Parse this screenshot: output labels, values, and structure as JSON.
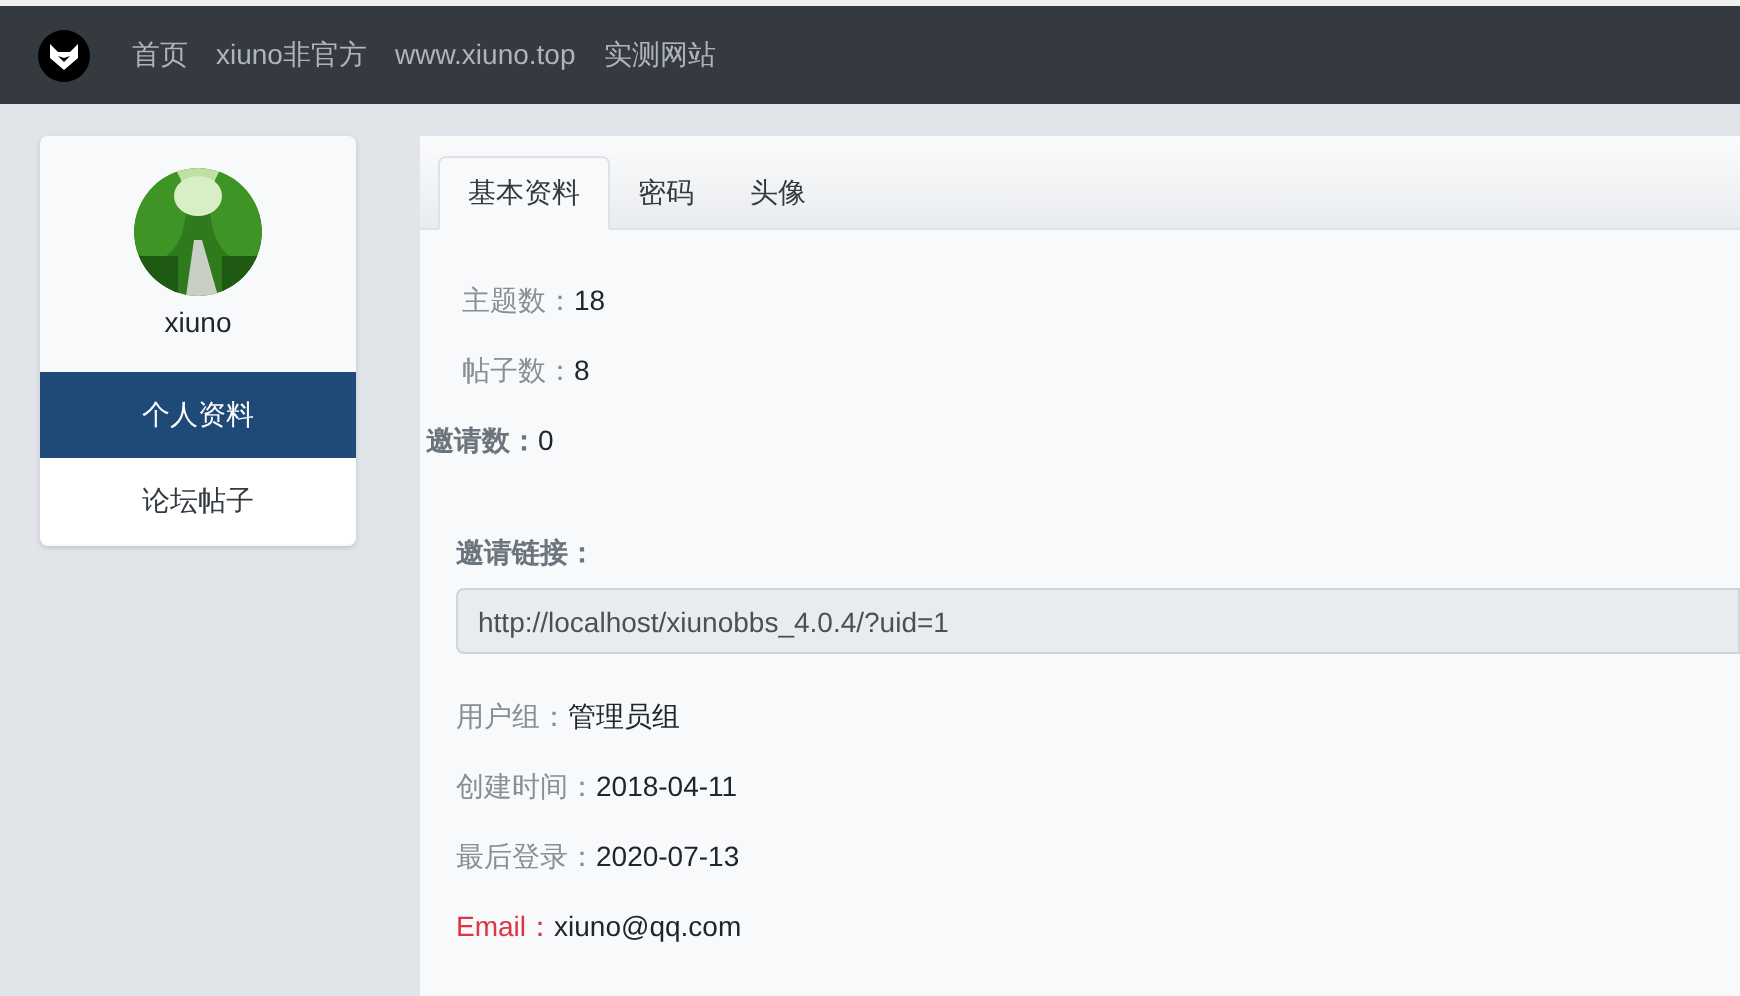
{
  "navbar": {
    "links": [
      "首页",
      "xiuno非官方",
      "www.xiuno.top",
      "实测网站"
    ]
  },
  "profile": {
    "username": "xiuno",
    "menu": [
      {
        "label": "个人资料",
        "selected": true
      },
      {
        "label": "论坛帖子",
        "selected": false
      }
    ]
  },
  "tabs": [
    {
      "label": "基本资料",
      "selected": true
    },
    {
      "label": "密码",
      "selected": false
    },
    {
      "label": "头像",
      "selected": false
    }
  ],
  "stats": [
    {
      "label": "主题数：",
      "value": "18",
      "kind": "plain"
    },
    {
      "label": "帖子数：",
      "value": "8",
      "kind": "plain"
    },
    {
      "label": "邀请数：",
      "value": "0",
      "kind": "strong"
    }
  ],
  "invite": {
    "label": "邀请链接：",
    "value": "http://localhost/xiunobbs_4.0.4/?uid=1"
  },
  "details": [
    {
      "label": "用户组：",
      "value": "管理员组",
      "kind": "plain"
    },
    {
      "label": "创建时间：",
      "value": "2018-04-11",
      "kind": "plain"
    },
    {
      "label": "最后登录：",
      "value": "2020-07-13",
      "kind": "plain"
    },
    {
      "label": "Email：",
      "value": "xiuno@qq.com",
      "kind": "alert"
    }
  ]
}
